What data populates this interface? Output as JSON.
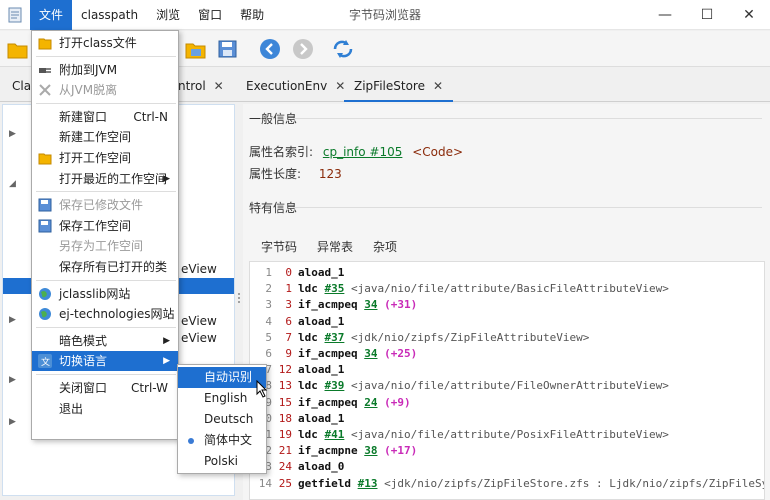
{
  "window": {
    "title": "字节码浏览器",
    "minimize": "—",
    "maximize": "☐",
    "close": "✕"
  },
  "menubar": [
    {
      "label": "文件",
      "active": true
    },
    {
      "label": "classpath",
      "active": false
    },
    {
      "label": "浏览",
      "active": false
    },
    {
      "label": "窗口",
      "active": false
    },
    {
      "label": "帮助",
      "active": false
    }
  ],
  "toolbar": {
    "icons": [
      "open-folder-icon",
      "open-folder-icon",
      "save-icon",
      "back-arrow-icon",
      "forward-arrow-icon",
      "refresh-icon"
    ]
  },
  "tabs": [
    {
      "label": "Clas",
      "closable": false
    },
    {
      "label": "ntrol",
      "closable": true
    },
    {
      "label": "ExecutionEnv",
      "closable": true
    },
    {
      "label": "ZipFileStore",
      "closable": true,
      "active": true
    }
  ],
  "tree": {
    "visible_texts": [
      "eView",
      "eView",
      "eView"
    ]
  },
  "file_menu": {
    "items": [
      {
        "label": "打开class文件",
        "icon": "open-folder-icon",
        "shortcut": "",
        "disabled": false
      },
      {
        "sep": true
      },
      {
        "label": "附加到JVM",
        "icon": "plug-icon",
        "shortcut": "",
        "disabled": false
      },
      {
        "label": "从JVM脱离",
        "icon": "unplug-icon",
        "shortcut": "",
        "disabled": true
      },
      {
        "sep": true
      },
      {
        "label": "新建窗口",
        "icon": "",
        "shortcut": "Ctrl-N",
        "disabled": false
      },
      {
        "label": "新建工作空间",
        "icon": "",
        "shortcut": "",
        "disabled": false
      },
      {
        "label": "打开工作空间",
        "icon": "open-folder-icon",
        "shortcut": "",
        "disabled": false
      },
      {
        "label": "打开最近的工作空间",
        "icon": "",
        "shortcut": "",
        "submenu": true,
        "disabled": false
      },
      {
        "sep": true
      },
      {
        "label": "保存已修改文件",
        "icon": "save-icon",
        "shortcut": "",
        "disabled": true
      },
      {
        "label": "保存工作空间",
        "icon": "save-icon",
        "shortcut": "",
        "disabled": false
      },
      {
        "label": "另存为工作空间",
        "icon": "",
        "shortcut": "",
        "disabled": true
      },
      {
        "label": "保存所有已打开的类",
        "icon": "",
        "shortcut": "",
        "disabled": false
      },
      {
        "sep": true
      },
      {
        "label": "jclasslib网站",
        "icon": "globe-icon",
        "shortcut": "",
        "disabled": false
      },
      {
        "label": "ej-technologies网站",
        "icon": "globe-icon",
        "shortcut": "",
        "disabled": false
      },
      {
        "sep": true
      },
      {
        "label": "暗色模式",
        "icon": "",
        "shortcut": "",
        "submenu": true,
        "disabled": false
      },
      {
        "label": "切换语言",
        "icon": "translate-icon",
        "shortcut": "",
        "submenu": true,
        "highlighted": true,
        "disabled": false
      },
      {
        "sep": true
      },
      {
        "label": "关闭窗口",
        "icon": "",
        "shortcut": "Ctrl-W",
        "disabled": false
      },
      {
        "label": "退出",
        "icon": "",
        "shortcut": "",
        "disabled": false
      }
    ]
  },
  "language_menu": {
    "items": [
      {
        "label": "自动识别",
        "highlighted": true,
        "selected": false
      },
      {
        "label": "English",
        "highlighted": false,
        "selected": false
      },
      {
        "label": "Deutsch",
        "highlighted": false,
        "selected": false
      },
      {
        "label": "简体中文",
        "highlighted": false,
        "selected": true
      },
      {
        "label": "Polski",
        "highlighted": false,
        "selected": false
      }
    ]
  },
  "detail": {
    "general_title": "一般信息",
    "attr_name_label": "属性名索引:",
    "attr_name_link": "cp_info #105",
    "attr_name_value": "<Code>",
    "attr_len_label": "属性长度:",
    "attr_len_value": "123",
    "specific_title": "特有信息",
    "subtabs": [
      "字节码",
      "异常表",
      "杂项"
    ]
  },
  "bytecode": [
    {
      "ln": "1",
      "off": "0",
      "op": "aload_1",
      "ref": "",
      "cmt": "",
      "jmp": ""
    },
    {
      "ln": "2",
      "off": "1",
      "op": "ldc",
      "ref": "#35",
      "cmt": "<java/nio/file/attribute/BasicFileAttributeView>",
      "jmp": ""
    },
    {
      "ln": "3",
      "off": "3",
      "op": "if_acmpeq",
      "ref": "34",
      "cmt": "",
      "jmp": "(+31)"
    },
    {
      "ln": "4",
      "off": "6",
      "op": "aload_1",
      "ref": "",
      "cmt": "",
      "jmp": ""
    },
    {
      "ln": "5",
      "off": "7",
      "op": "ldc",
      "ref": "#37",
      "cmt": "<jdk/nio/zipfs/ZipFileAttributeView>",
      "jmp": ""
    },
    {
      "ln": "6",
      "off": "9",
      "op": "if_acmpeq",
      "ref": "34",
      "cmt": "",
      "jmp": "(+25)"
    },
    {
      "ln": "7",
      "off": "12",
      "op": "aload_1",
      "ref": "",
      "cmt": "",
      "jmp": ""
    },
    {
      "ln": "8",
      "off": "13",
      "op": "ldc",
      "ref": "#39",
      "cmt": "<java/nio/file/attribute/FileOwnerAttributeView>",
      "jmp": ""
    },
    {
      "ln": "9",
      "off": "15",
      "op": "if_acmpeq",
      "ref": "24",
      "cmt": "",
      "jmp": "(+9)"
    },
    {
      "ln": "10",
      "off": "18",
      "op": "aload_1",
      "ref": "",
      "cmt": "",
      "jmp": ""
    },
    {
      "ln": "11",
      "off": "19",
      "op": "ldc",
      "ref": "#41",
      "cmt": "<java/nio/file/attribute/PosixFileAttributeView>",
      "jmp": ""
    },
    {
      "ln": "12",
      "off": "21",
      "op": "if_acmpne",
      "ref": "38",
      "cmt": "",
      "jmp": "(+17)"
    },
    {
      "ln": "13",
      "off": "24",
      "op": "aload_0",
      "ref": "",
      "cmt": "",
      "jmp": ""
    },
    {
      "ln": "14",
      "off": "25",
      "op": "getfield",
      "ref": "#13",
      "cmt": "<jdk/nio/zipfs/ZipFileStore.zfs : Ljdk/nio/zipfs/ZipFileSystem>",
      "jmp": ""
    }
  ]
}
